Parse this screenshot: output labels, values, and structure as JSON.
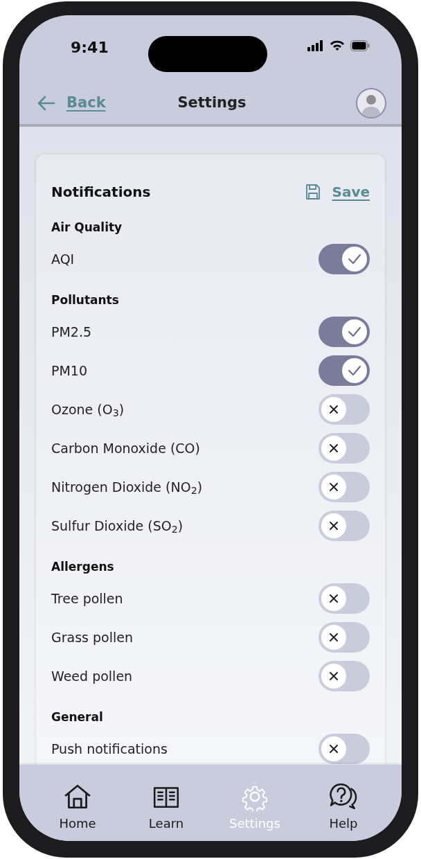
{
  "status_bar": {
    "time": "9:41"
  },
  "header": {
    "back_label": "Back",
    "title": "Settings"
  },
  "card": {
    "title": "Notifications",
    "save_label": "Save",
    "sections": [
      {
        "heading": "Air Quality",
        "items": [
          {
            "label": "AQI",
            "on": true
          }
        ]
      },
      {
        "heading": "Pollutants",
        "items": [
          {
            "label": "PM2.5",
            "on": true
          },
          {
            "label": "PM10",
            "on": true
          },
          {
            "label": "Ozone (O$_{3}$)",
            "on": false
          },
          {
            "label": "Carbon Monoxide (CO)",
            "on": false
          },
          {
            "label": "Nitrogen Dioxide (NO$_{2}$)",
            "on": false
          },
          {
            "label": "Sulfur Dioxide (SO$_{2}$)",
            "on": false
          }
        ]
      },
      {
        "heading": "Allergens",
        "items": [
          {
            "label": "Tree pollen",
            "on": false
          },
          {
            "label": "Grass pollen",
            "on": false
          },
          {
            "label": "Weed pollen",
            "on": false
          }
        ]
      },
      {
        "heading": "General",
        "items": [
          {
            "label": "Push notifications",
            "on": false
          }
        ]
      }
    ]
  },
  "nav": [
    {
      "label": "Home",
      "kind": "home",
      "selected": false
    },
    {
      "label": "Learn",
      "kind": "book",
      "selected": false
    },
    {
      "label": "Settings",
      "kind": "gear",
      "selected": true
    },
    {
      "label": "Help",
      "kind": "help",
      "selected": false
    }
  ]
}
